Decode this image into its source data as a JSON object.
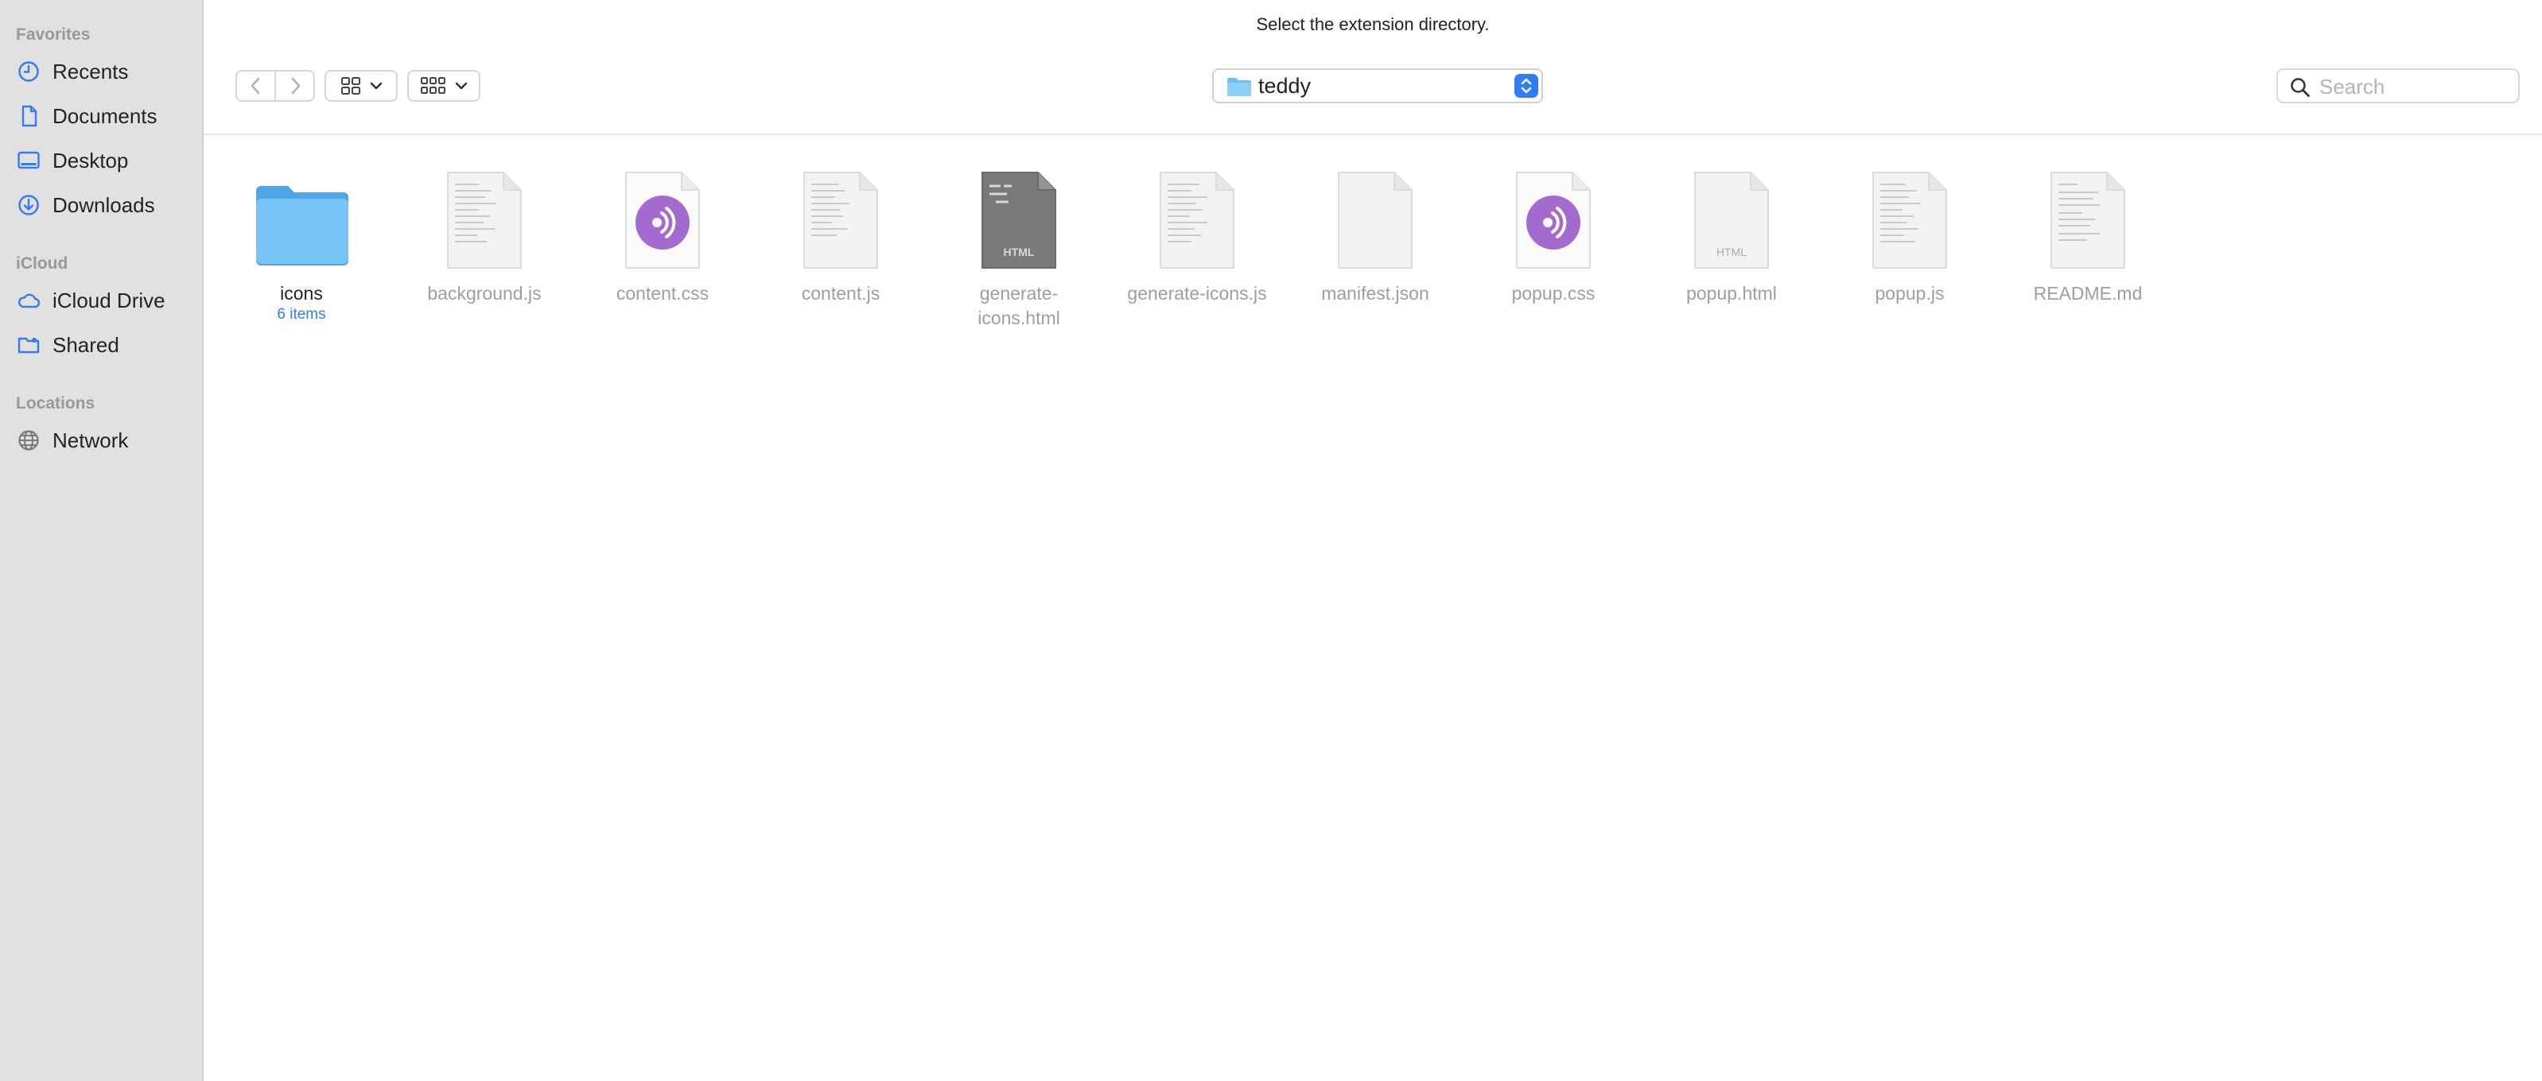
{
  "dialog": {
    "prompt": "Select the extension directory."
  },
  "sidebar": {
    "sections": [
      {
        "title": "Favorites",
        "items": [
          {
            "label": "Recents",
            "icon": "clock-icon"
          },
          {
            "label": "Documents",
            "icon": "document-icon"
          },
          {
            "label": "Desktop",
            "icon": "desktop-icon"
          },
          {
            "label": "Downloads",
            "icon": "download-icon"
          }
        ]
      },
      {
        "title": "iCloud",
        "items": [
          {
            "label": "iCloud Drive",
            "icon": "cloud-icon"
          },
          {
            "label": "Shared",
            "icon": "shared-folder-icon"
          }
        ]
      },
      {
        "title": "Locations",
        "items": [
          {
            "label": "Network",
            "icon": "globe-icon"
          }
        ]
      }
    ]
  },
  "toolbar": {
    "current_folder": "teddy",
    "search_placeholder": "Search"
  },
  "files": [
    {
      "name": "icons",
      "kind": "folder",
      "subtitle": "6 items"
    },
    {
      "name": "background.js",
      "kind": "text"
    },
    {
      "name": "content.css",
      "kind": "css"
    },
    {
      "name": "content.js",
      "kind": "text"
    },
    {
      "name": "generate-\nicons.html",
      "kind": "html-dark",
      "badge": "HTML"
    },
    {
      "name": "generate-icons.js",
      "kind": "text"
    },
    {
      "name": "manifest.json",
      "kind": "blank"
    },
    {
      "name": "popup.css",
      "kind": "css"
    },
    {
      "name": "popup.html",
      "kind": "html",
      "badge": "HTML"
    },
    {
      "name": "popup.js",
      "kind": "text"
    },
    {
      "name": "README.md",
      "kind": "text"
    }
  ],
  "colors": {
    "accent": "#2f7cf6",
    "sidebar_bg": "#e3e1df",
    "folder": "#6ec0f5",
    "css_icon": "#a36bd0"
  }
}
